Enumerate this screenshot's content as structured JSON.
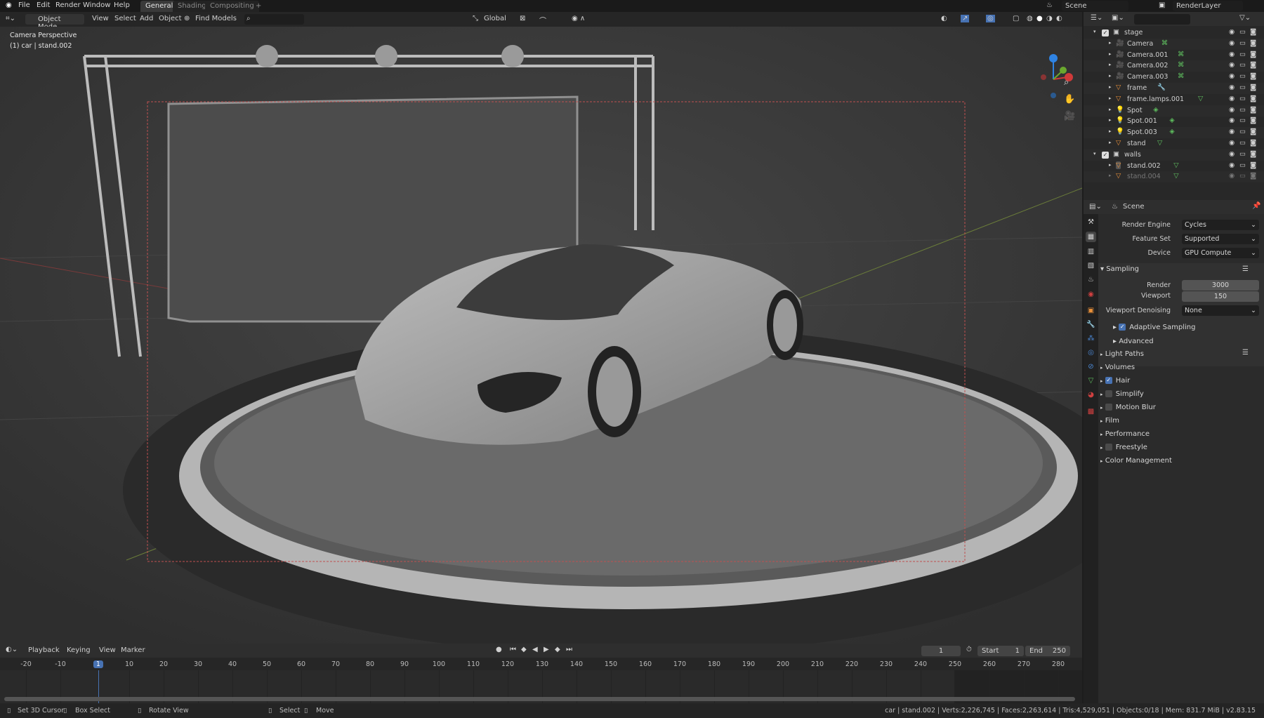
{
  "topbar": {
    "menus": [
      "File",
      "Edit",
      "Render",
      "Window",
      "Help"
    ],
    "workspaces": [
      "General",
      "Shading",
      "Compositing"
    ],
    "add_workspace": "+",
    "scene": "Scene",
    "render_layer": "RenderLayer"
  },
  "viewport_header": {
    "mode": "Object Mode",
    "menus": [
      "View",
      "Select",
      "Add",
      "Object"
    ],
    "find_models": "Find Models",
    "search_placeholder": "",
    "orientation": "Global"
  },
  "viewport": {
    "camera_label": "Camera Perspective",
    "object_info": "(1) car | stand.002",
    "gizmo_axes": [
      "Z",
      "Y",
      "X"
    ]
  },
  "outliner": {
    "search_placeholder": "",
    "rows": [
      {
        "name": "stage",
        "type": "collection",
        "depth": 0,
        "checked": true
      },
      {
        "name": "Camera",
        "type": "camera",
        "depth": 1,
        "extra": "camera-data-icon"
      },
      {
        "name": "Camera.001",
        "type": "camera",
        "depth": 1,
        "extra": "camera-data-icon"
      },
      {
        "name": "Camera.002",
        "type": "camera",
        "depth": 1,
        "extra": "camera-data-icon"
      },
      {
        "name": "Camera.003",
        "type": "camera",
        "depth": 1,
        "extra": "camera-data-icon"
      },
      {
        "name": "frame",
        "type": "mesh",
        "depth": 1,
        "extra": "modifier-wrench-icon"
      },
      {
        "name": "frame.lamps.001",
        "type": "mesh",
        "depth": 1,
        "extra": "mesh-data-icon"
      },
      {
        "name": "Spot",
        "type": "light",
        "depth": 1,
        "extra": "light-data-icon"
      },
      {
        "name": "Spot.001",
        "type": "light",
        "depth": 1,
        "extra": "light-data-icon"
      },
      {
        "name": "Spot.003",
        "type": "light",
        "depth": 1,
        "extra": "light-data-icon"
      },
      {
        "name": "stand",
        "type": "mesh",
        "depth": 1,
        "extra": "mesh-data-icon"
      },
      {
        "name": "walls",
        "type": "collection",
        "depth": 0,
        "checked": true
      },
      {
        "name": "stand.002",
        "type": "mesh",
        "depth": 1,
        "extra": "mesh-data-icon",
        "selected": true
      },
      {
        "name": "stand.004",
        "type": "mesh",
        "depth": 1,
        "extra": "mesh-data-icon",
        "disabled": true
      }
    ]
  },
  "properties": {
    "context": "Scene",
    "render_engine_label": "Render Engine",
    "render_engine": "Cycles",
    "feature_set_label": "Feature Set",
    "feature_set": "Supported",
    "device_label": "Device",
    "device": "GPU Compute",
    "sampling": "Sampling",
    "render_label": "Render",
    "render_samples": "3000",
    "viewport_label": "Viewport",
    "viewport_samples": "150",
    "denoise_label": "Viewport Denoising",
    "denoise": "None",
    "adaptive": "Adaptive Sampling",
    "adaptive_on": true,
    "advanced": "Advanced",
    "panels": [
      {
        "label": "Light Paths"
      },
      {
        "label": "Volumes"
      },
      {
        "label": "Hair",
        "checkbox": true,
        "checked": true
      },
      {
        "label": "Simplify",
        "checkbox": true,
        "checked": false
      },
      {
        "label": "Motion Blur",
        "checkbox": true,
        "checked": false
      },
      {
        "label": "Film"
      },
      {
        "label": "Performance"
      },
      {
        "label": "Freestyle",
        "checkbox": true,
        "checked": false
      },
      {
        "label": "Color Management"
      }
    ]
  },
  "timeline": {
    "menus": [
      "Playback",
      "Keying",
      "View",
      "Marker"
    ],
    "current_frame": "1",
    "start_label": "Start",
    "start": "1",
    "end_label": "End",
    "end": "250",
    "ticks": [
      "-20",
      "-10",
      "1",
      "10",
      "20",
      "30",
      "40",
      "50",
      "60",
      "70",
      "80",
      "90",
      "100",
      "110",
      "120",
      "130",
      "140",
      "150",
      "160",
      "170",
      "180",
      "190",
      "200",
      "210",
      "220",
      "230",
      "240",
      "250",
      "260",
      "270",
      "280"
    ]
  },
  "statusbar": {
    "set_cursor": "Set 3D Cursor",
    "box_select": "Box Select",
    "rotate_view": "Rotate View",
    "select": "Select",
    "move": "Move",
    "stats": "car | stand.002 | Verts:2,226,745 | Faces:2,263,614 | Tris:4,529,051 | Objects:0/18 | Mem: 831.7 MiB | v2.83.15"
  },
  "colors": {
    "accent": "#4772b3",
    "object_orange": "#e8903a",
    "data_green": "#5fbf5f"
  }
}
